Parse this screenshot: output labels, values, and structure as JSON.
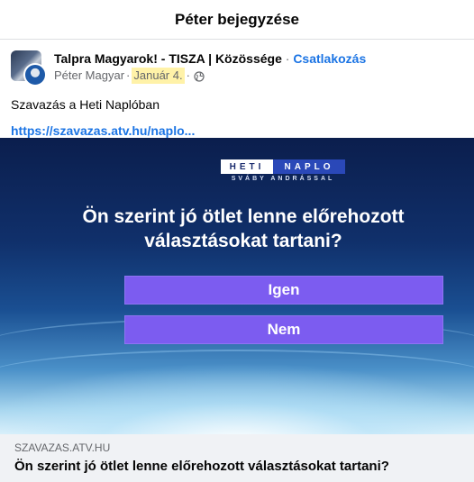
{
  "topbar": {
    "title": "Péter bejegyzése"
  },
  "post": {
    "group_name": "Talpra Magyarok! - TISZA | Közössége",
    "separator": "·",
    "join_label": "Csatlakozás",
    "author": "Péter Magyar",
    "date": "Január 4.",
    "privacy_icon": "globe-icon",
    "text": "Szavazás a Heti Naplóban",
    "link": "https://szavazas.atv.hu/naplo..."
  },
  "media": {
    "logo_left": "HETI",
    "logo_right": "NAPLO",
    "logo_sub": "SVÁBY ANDRÁSSAL",
    "question": "Ön szerint jó ötlet lenne előrehozott választásokat tartani?",
    "option_yes": "Igen",
    "option_no": "Nem"
  },
  "link_preview": {
    "domain": "SZAVAZAS.ATV.HU",
    "title": "Ön szerint jó ötlet lenne előrehozott választásokat tartani?"
  },
  "colors": {
    "link": "#1b74e4",
    "button": "#7c5cf0",
    "highlight": "#fff2a8"
  }
}
